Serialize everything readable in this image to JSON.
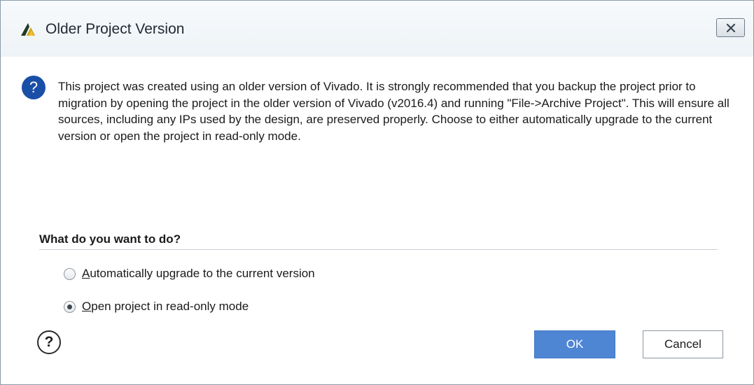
{
  "window": {
    "title": "Older Project Version",
    "logo_icon": "vivado-logo-icon",
    "close_icon": "close-icon"
  },
  "message": {
    "icon": "question-icon",
    "icon_glyph": "?",
    "text": "This project was created using an older version of Vivado. It is strongly recommended that you backup the project prior to migration by opening the project in the older version of Vivado (v2016.4) and running \"File->Archive Project\". This will ensure all sources, including any IPs used by the design, are preserved properly. Choose to either automatically upgrade to the current version or open the project in read-only mode."
  },
  "options": {
    "heading": "What do you want to do?",
    "items": [
      {
        "label": "Automatically upgrade to the current version",
        "selected": false
      },
      {
        "label": "Open project in read-only mode",
        "selected": true
      }
    ]
  },
  "footer": {
    "help_icon": "help-icon",
    "help_glyph": "?",
    "ok_label": "OK",
    "cancel_label": "Cancel"
  },
  "colors": {
    "accent": "#4f86d4",
    "question_icon": "#1a4fa8"
  }
}
